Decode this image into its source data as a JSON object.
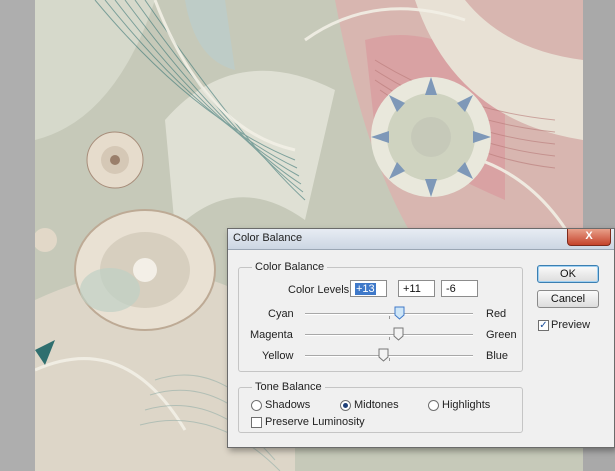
{
  "dialog": {
    "title": "Color Balance",
    "close_label": "X",
    "color_balance": {
      "group_label": "Color Balance",
      "levels_label": "Color Levels:",
      "levels": [
        "+13",
        "+11",
        "-6"
      ],
      "sliders": [
        {
          "left": "Cyan",
          "right": "Red",
          "value": 13
        },
        {
          "left": "Magenta",
          "right": "Green",
          "value": 11
        },
        {
          "left": "Yellow",
          "right": "Blue",
          "value": -6
        }
      ]
    },
    "tone_balance": {
      "group_label": "Tone Balance",
      "shadows": "Shadows",
      "midtones": "Midtones",
      "highlights": "Highlights",
      "selected": "midtones",
      "preserve_luminosity": "Preserve Luminosity",
      "preserve_checked": false
    },
    "buttons": {
      "ok": "OK",
      "cancel": "Cancel"
    },
    "preview": {
      "label": "Preview",
      "checked": true
    }
  },
  "colors": {
    "accent": "#3f79c9",
    "close": "#c5432b",
    "canvas": "#c9cbbd"
  }
}
